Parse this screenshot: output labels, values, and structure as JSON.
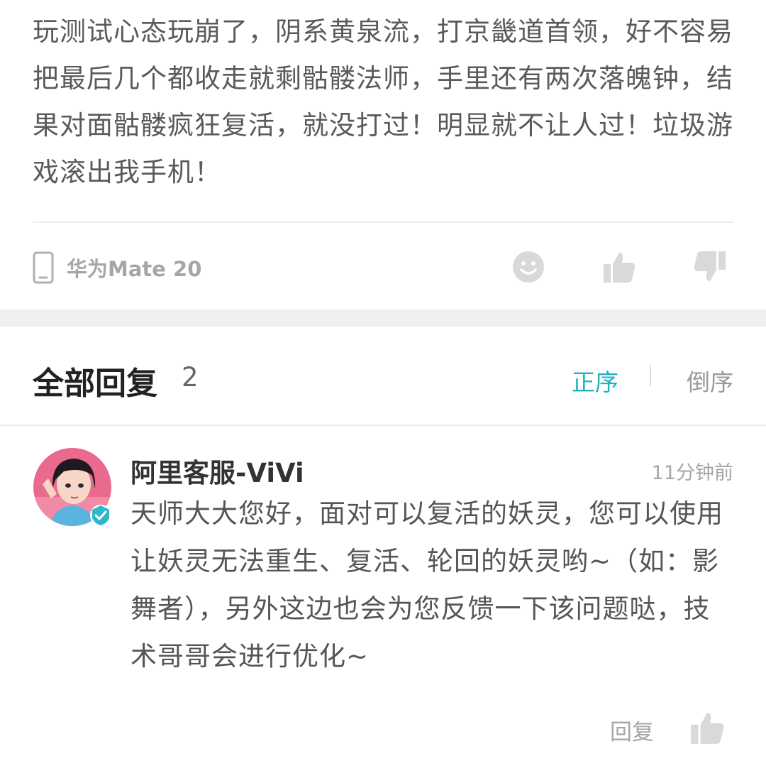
{
  "post": {
    "text": "玩测试心态玩崩了，阴系黄泉流，打京畿道首领，好不容易把最后几个都收走就剩骷髅法师，手里还有两次落魄钟，结果对面骷髅疯狂复活，就没打过！明显就不让人过！垃圾游戏滚出我手机！",
    "device": "华为Mate 20",
    "device_icon": "phone-icon",
    "action_icons": [
      "emoji-icon",
      "thumbs-up-icon",
      "thumbs-down-icon"
    ]
  },
  "replies": {
    "title": "全部回复",
    "count": "2",
    "sort_asc": "正序",
    "sort_desc": "倒序",
    "accent_color": "#1fb2c0"
  },
  "reply": {
    "author": "阿里客服-ViVi",
    "time": "11分钟前",
    "text": "天师大大您好，面对可以复活的妖灵，您可以使用让妖灵无法重生、复活、轮回的妖灵哟~（如：影舞者），另外这边也会为您反馈一下该问题哒，技术哥哥会进行优化~",
    "reply_label": "回复",
    "verified_badge_color": "#2cb8c8"
  }
}
